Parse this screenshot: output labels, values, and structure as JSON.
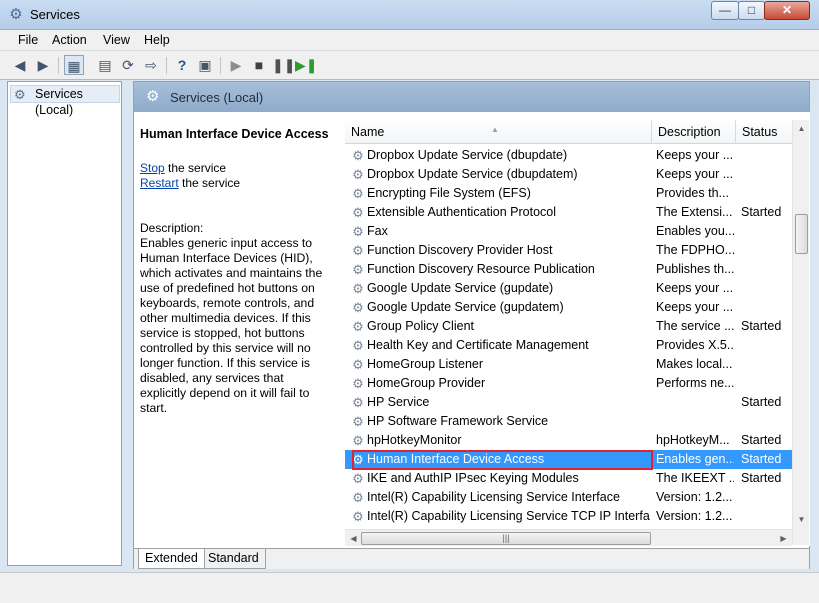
{
  "window": {
    "title": "Services"
  },
  "menu": [
    "File",
    "Action",
    "View",
    "Help"
  ],
  "tree": {
    "item": "Services (Local)"
  },
  "panel": {
    "header": "Services (Local)",
    "service_title": "Human Interface Device Access",
    "stop_link": "Stop",
    "stop_suffix": " the service",
    "restart_link": "Restart",
    "restart_suffix": " the service",
    "description_label": "Description:",
    "description": "Enables generic input access to Human Interface Devices (HID), which activates and maintains the use of predefined hot buttons on keyboards, remote controls, and other multimedia devices. If this service is stopped, hot buttons controlled by this service will no longer function. If this service is disabled, any services that explicitly depend on it will fail to start."
  },
  "columns": {
    "name": "Name",
    "description": "Description",
    "status": "Status"
  },
  "services": [
    {
      "name": "Dropbox Update Service (dbupdate)",
      "description": "Keeps your ...",
      "status": ""
    },
    {
      "name": "Dropbox Update Service (dbupdatem)",
      "description": "Keeps your ...",
      "status": ""
    },
    {
      "name": "Encrypting File System (EFS)",
      "description": "Provides th...",
      "status": ""
    },
    {
      "name": "Extensible Authentication Protocol",
      "description": "The Extensi...",
      "status": "Started"
    },
    {
      "name": "Fax",
      "description": "Enables you...",
      "status": ""
    },
    {
      "name": "Function Discovery Provider Host",
      "description": "The FDPHO...",
      "status": ""
    },
    {
      "name": "Function Discovery Resource Publication",
      "description": "Publishes th...",
      "status": ""
    },
    {
      "name": "Google Update Service (gupdate)",
      "description": "Keeps your ...",
      "status": ""
    },
    {
      "name": "Google Update Service (gupdatem)",
      "description": "Keeps your ...",
      "status": ""
    },
    {
      "name": "Group Policy Client",
      "description": "The service ...",
      "status": "Started"
    },
    {
      "name": "Health Key and Certificate Management",
      "description": "Provides X.5...",
      "status": ""
    },
    {
      "name": "HomeGroup Listener",
      "description": "Makes local...",
      "status": ""
    },
    {
      "name": "HomeGroup Provider",
      "description": "Performs ne...",
      "status": ""
    },
    {
      "name": "HP Service",
      "description": "",
      "status": "Started"
    },
    {
      "name": "HP Software Framework Service",
      "description": "",
      "status": ""
    },
    {
      "name": "hpHotkeyMonitor",
      "description": "hpHotkeyM...",
      "status": "Started"
    },
    {
      "name": "Human Interface Device Access",
      "description": "Enables gen...",
      "status": "Started",
      "selected": true
    },
    {
      "name": "IKE and AuthIP IPsec Keying Modules",
      "description": "The IKEEXT ...",
      "status": "Started"
    },
    {
      "name": "Intel(R) Capability Licensing Service Interface",
      "description": "Version: 1.2...",
      "status": ""
    },
    {
      "name": "Intel(R) Capability Licensing Service TCP IP Interface",
      "description": "Version: 1.2...",
      "status": ""
    }
  ],
  "tabs": [
    "Extended",
    "Standard"
  ],
  "colors": {
    "selection": "#3399ff",
    "highlight_box": "#e2222e",
    "header_bar": "#9bb5d1"
  },
  "icons": {
    "title": "gear-icon",
    "service": "gear-icon"
  }
}
